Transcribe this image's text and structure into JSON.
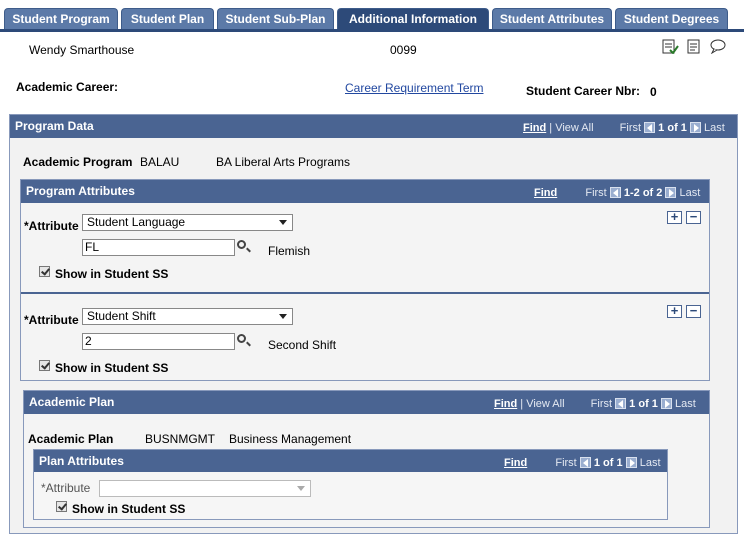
{
  "tabs": [
    {
      "label": "Student Program"
    },
    {
      "label": "Student Plan"
    },
    {
      "label": "Student Sub-Plan"
    },
    {
      "label": "Additional Information"
    },
    {
      "label": "Student Attributes"
    },
    {
      "label": "Student Degrees"
    }
  ],
  "active_tab": "Additional Information",
  "student": {
    "name": "Wendy Smarthouse",
    "id": "0099",
    "academic_career_label": "Academic Career:",
    "career_req_term_link": "Career Requirement Term",
    "career_nbr_label": "Student Career Nbr:",
    "career_nbr_value": "0"
  },
  "program_data": {
    "title": "Program Data",
    "nav": {
      "find": "Find",
      "view_all": "View All",
      "first": "First",
      "count": "1 of 1",
      "last": "Last"
    },
    "academic_program_label": "Academic Program",
    "academic_program_code": "BALAU",
    "academic_program_desc": "BA Liberal Arts Programs"
  },
  "program_attributes": {
    "title": "Program Attributes",
    "nav": {
      "find": "Find",
      "first": "First",
      "count": "1-2 of 2",
      "last": "Last"
    },
    "rows": [
      {
        "attribute_label": "*Attribute",
        "attribute_value": "Student Language",
        "code": "FL",
        "code_desc": "Flemish",
        "show_ss_label": "Show in Student SS",
        "show_ss": true
      },
      {
        "attribute_label": "*Attribute",
        "attribute_value": "Student Shift",
        "code": "2",
        "code_desc": "Second Shift",
        "show_ss_label": "Show in Student SS",
        "show_ss": true
      }
    ],
    "add_label": "+",
    "delete_label": "−"
  },
  "academic_plan": {
    "title": "Academic Plan",
    "nav": {
      "find": "Find",
      "view_all": "View All",
      "first": "First",
      "count": "1 of 1",
      "last": "Last"
    },
    "plan_label": "Academic Plan",
    "plan_code": "BUSNMGMT",
    "plan_desc": "Business Management"
  },
  "plan_attributes": {
    "title": "Plan Attributes",
    "nav": {
      "find": "Find",
      "first": "First",
      "count": "1 of 1",
      "last": "Last"
    },
    "attribute_label": "*Attribute",
    "attribute_value": "",
    "show_ss_label": "Show in Student SS",
    "show_ss": true
  },
  "colors": {
    "header_bg": "#4a6492",
    "tab_bg": "#5c7aa8",
    "tab_active_bg": "#2d4a79",
    "link": "#2248a0"
  },
  "icons": [
    "notepad-check-icon",
    "notepad-icon",
    "speech-bubble-icon",
    "lookup-magnifier-icon",
    "nav-left-icon",
    "nav-right-icon",
    "dropdown-arrow-icon",
    "checkbox-checked-icon"
  ]
}
